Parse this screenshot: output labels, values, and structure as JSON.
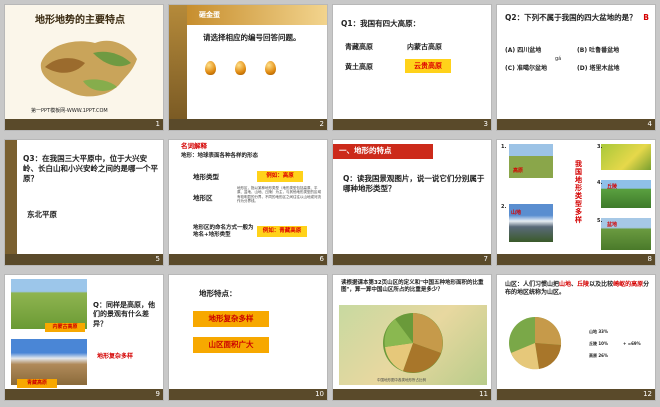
{
  "slides": [
    {
      "number": "1",
      "title": "地形地势的主要特点",
      "footer_credit": "第一PPT模板网-WWW.1PPT.COM"
    },
    {
      "number": "2",
      "title": "砸金蛋",
      "prompt": "请选择相应的编号回答问题。"
    },
    {
      "number": "3",
      "question": "Q1：我国有四大高原：",
      "options": [
        "青藏高原",
        "内蒙古高原",
        "黄土高原",
        "云贵高原"
      ]
    },
    {
      "number": "4",
      "question": "Q2：下列不属于我国的四大盆地的是？",
      "answer": "B",
      "options": [
        "(A) 四川盆地",
        "(B) 吐鲁番盆地",
        "(C) 准噶尔盆地",
        "(D) 塔里木盆地"
      ],
      "ruby": "gá"
    },
    {
      "number": "5",
      "question": "Q3：在我国三大平原中，位于大兴安岭、长白山和小兴安岭之间的是哪一个平原？",
      "answer": "东北平原"
    },
    {
      "number": "6",
      "heading": "名词解释",
      "definition": "地形：地球表面各种各样的形态",
      "row1_label": "地形类型",
      "row1_example": "例如：高原",
      "row2_label": "地形区",
      "row2_text": "地形区，指以某种地形类型（地形类型包括高原、平原、盆地、山地、丘陵）为主，与其他地形类型的区域有较明显的分界，不同的地形区之间往往以山地或河流作为分界线。",
      "row3_label": "地形区的命名方式一般为地名+地形类型",
      "row3_example": "例如：青藏高原"
    },
    {
      "number": "7",
      "heading": "一、地形的特点",
      "question": "Q：读我国景观图片，说一说它们分别属于哪种地形类型？"
    },
    {
      "number": "8",
      "vertical_title": "我国地形类型多样",
      "labels": [
        "高原",
        "山地",
        "平原",
        "丘陵",
        "盆地"
      ],
      "photo_numbers": [
        "1.",
        "2.",
        "3.",
        "4.",
        "5."
      ]
    },
    {
      "number": "9",
      "question": "Q：同样是高原，他们的景观有什么差异？",
      "photo1_label": "内蒙古高原",
      "photo2_label": "青藏高原",
      "answer": "地形复杂多样"
    },
    {
      "number": "10",
      "heading": "地形特点：",
      "point1": "地形复杂多样",
      "point2": "山区面积广大"
    },
    {
      "number": "11",
      "question": "读根据课本第32页山区的定义和\"中国五种地形面积的比重图\"，算一算中国山区所占的比重是多少？",
      "caption": "中国地形图中各类地形所占比例"
    },
    {
      "number": "12",
      "text_pre": "山区：人们习惯山把",
      "hl1": "山地",
      "sep1": "、",
      "hl2": "丘陵",
      "text_mid": "以及比较",
      "hl3": "崎岖的高原",
      "text_post": "分布的地区统称为山区。",
      "legend": [
        "山地 33%",
        "丘陵 10%",
        "高原 26%"
      ],
      "sum": "+ =69%"
    }
  ]
}
